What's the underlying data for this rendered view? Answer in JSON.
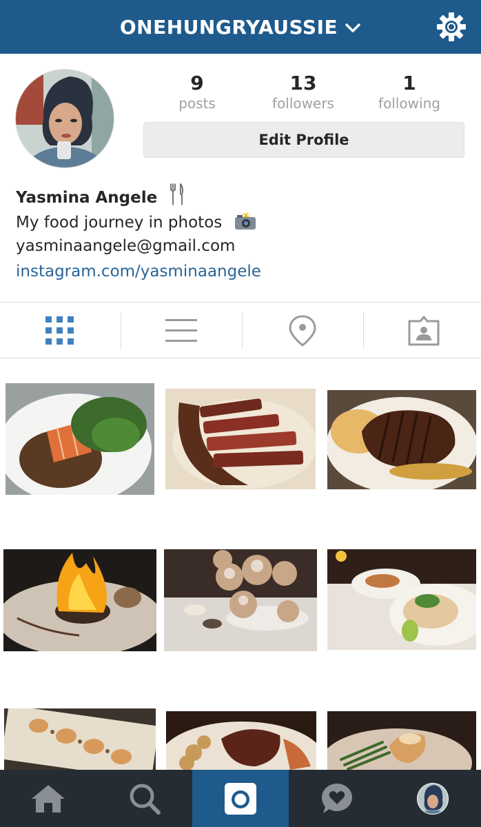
{
  "header": {
    "username": "ONEHUNGRYAUSSIE",
    "chevron_icon": "chevron-down-icon",
    "settings_icon": "gear-icon",
    "bg_color": "#1f5a8c"
  },
  "profile": {
    "stats": [
      {
        "count": "9",
        "label": "posts"
      },
      {
        "count": "13",
        "label": "followers"
      },
      {
        "count": "1",
        "label": "following"
      }
    ],
    "edit_button": "Edit Profile",
    "bio": {
      "name": "Yasmina Angele",
      "name_icon": "fork-knife-icon",
      "tagline": "My food journey in photos",
      "tagline_icon": "camera-flash-icon",
      "email": "yasminaangele@gmail.com",
      "link": "instagram.com/yasminaangele"
    }
  },
  "view_tabs": [
    {
      "name": "grid",
      "icon": "grid-icon",
      "active": true
    },
    {
      "name": "list",
      "icon": "list-icon",
      "active": false
    },
    {
      "name": "map",
      "icon": "location-pin-icon",
      "active": false
    },
    {
      "name": "tagged",
      "icon": "tagged-photo-icon",
      "active": false
    }
  ],
  "photos": [
    {
      "subject": "salmon with grains and arugula"
    },
    {
      "subject": "sliced tomahawk steak"
    },
    {
      "subject": "ribeye steak with creamed corn"
    },
    {
      "subject": "flambe dessert plate with writing"
    },
    {
      "subject": "powdered doughnuts on a stand"
    },
    {
      "subject": "fish tacos with lime"
    },
    {
      "subject": "scallops on a plate"
    },
    {
      "subject": "sausage with beans"
    },
    {
      "subject": "grilled fish with asparagus"
    }
  ],
  "bottom_nav": [
    {
      "name": "home",
      "icon": "home-icon",
      "active": false
    },
    {
      "name": "search",
      "icon": "search-icon",
      "active": false
    },
    {
      "name": "camera",
      "icon": "camera-icon",
      "active": true
    },
    {
      "name": "activity",
      "icon": "heart-bubble-icon",
      "active": false
    },
    {
      "name": "profile",
      "icon": "avatar",
      "active": false
    }
  ],
  "colors": {
    "accent": "#1f5a8c",
    "link": "#2a6496",
    "grid_active": "#3f81c0",
    "icon_inactive": "#9a9a9a",
    "nav_bg": "#262c33"
  }
}
